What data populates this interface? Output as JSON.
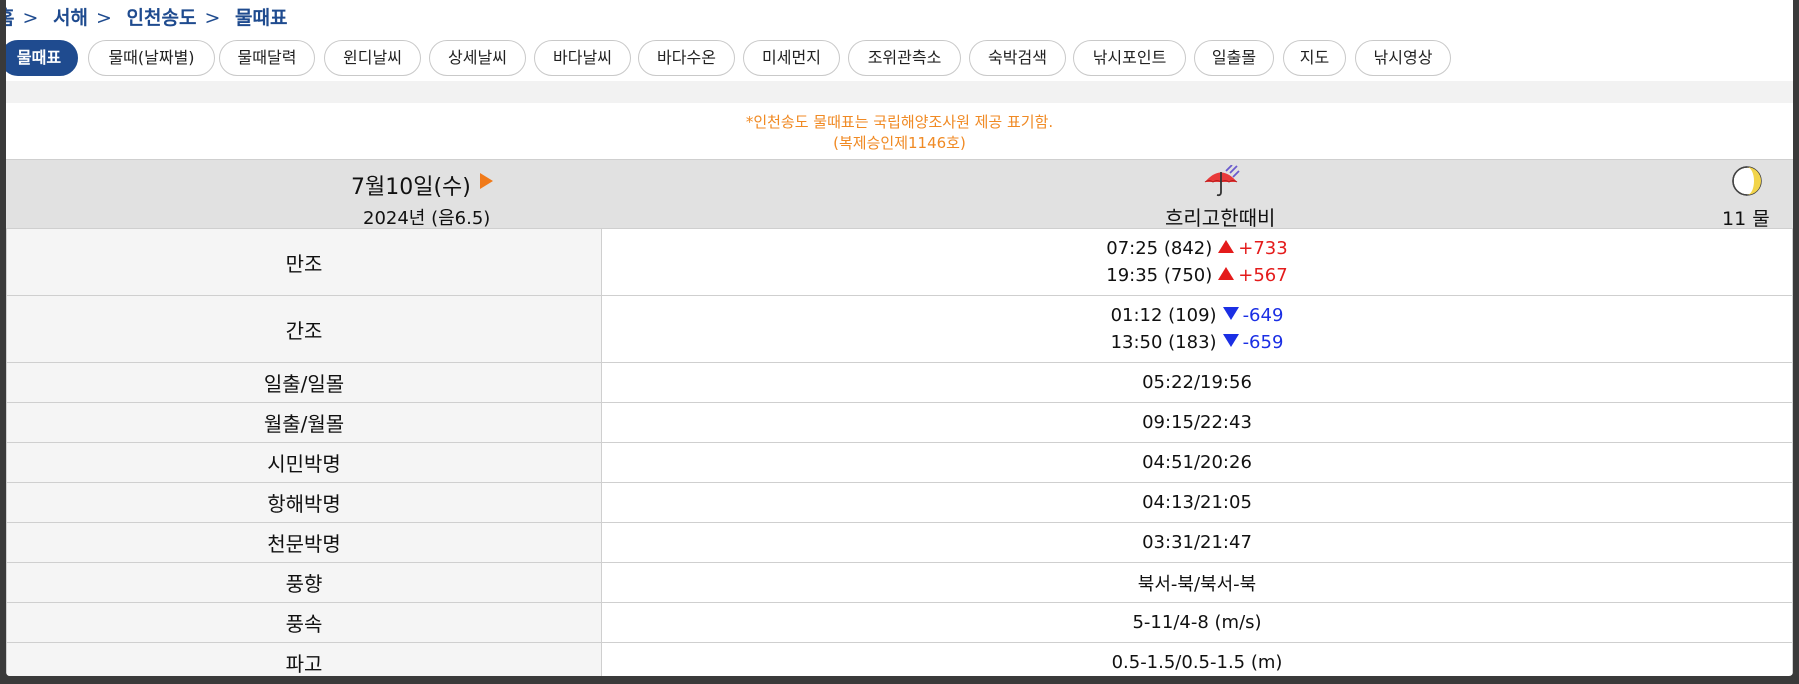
{
  "breadcrumb": {
    "home": "홈",
    "sep": ">",
    "region": "서해",
    "place": "인천송도",
    "current": "물때표"
  },
  "tabs": [
    {
      "label": "물때표",
      "active": true
    },
    {
      "label": "물때(날짜별)"
    },
    {
      "label": "물때달력"
    },
    {
      "label": "윈디날씨"
    },
    {
      "label": "상세날씨"
    },
    {
      "label": "바다날씨"
    },
    {
      "label": "바다수온"
    },
    {
      "label": "미세먼지"
    },
    {
      "label": "조위관측소"
    },
    {
      "label": "숙박검색"
    },
    {
      "label": "낚시포인트"
    },
    {
      "label": "일출몰"
    },
    {
      "label": "지도"
    },
    {
      "label": "낚시영상"
    }
  ],
  "notice": {
    "line1": "*인천송도 물때표는 국립해양조사원 제공 표기함.",
    "line2": "(복제승인제1146호)"
  },
  "day": {
    "date": "7월10일(수)",
    "year_lunar": "2024년 (음6.5)",
    "weather": "흐리고한때비",
    "weather_icon": "umbrella-rain-icon",
    "moon_icon": "half-moon-icon",
    "tide": "11 물"
  },
  "rows": {
    "high": {
      "label": "만조",
      "t1": "07:25 (842)",
      "d1": "+733",
      "t2": "19:35 (750)",
      "d2": "+567"
    },
    "low": {
      "label": "간조",
      "t1": "01:12 (109)",
      "d1": "-649",
      "t2": "13:50 (183)",
      "d2": "-659"
    },
    "sun": {
      "label": "일출/일몰",
      "value": "05:22/19:56"
    },
    "moon": {
      "label": "월출/월몰",
      "value": "09:15/22:43"
    },
    "civil": {
      "label": "시민박명",
      "value": "04:51/20:26"
    },
    "nautical": {
      "label": "항해박명",
      "value": "04:13/21:05"
    },
    "astro": {
      "label": "천문박명",
      "value": "03:31/21:47"
    },
    "wind_dir": {
      "label": "풍향",
      "value": "북서-북/북서-북"
    },
    "wind_speed": {
      "label": "풍속",
      "value": "5-11/4-8 (m/s)"
    },
    "wave": {
      "label": "파고",
      "value": "0.5-1.5/0.5-1.5 (m)"
    }
  },
  "colors": {
    "accent": "#1f4b8f",
    "notice": "#f08a24",
    "rise": "#e41b1b",
    "fall": "#1b2fe4"
  }
}
